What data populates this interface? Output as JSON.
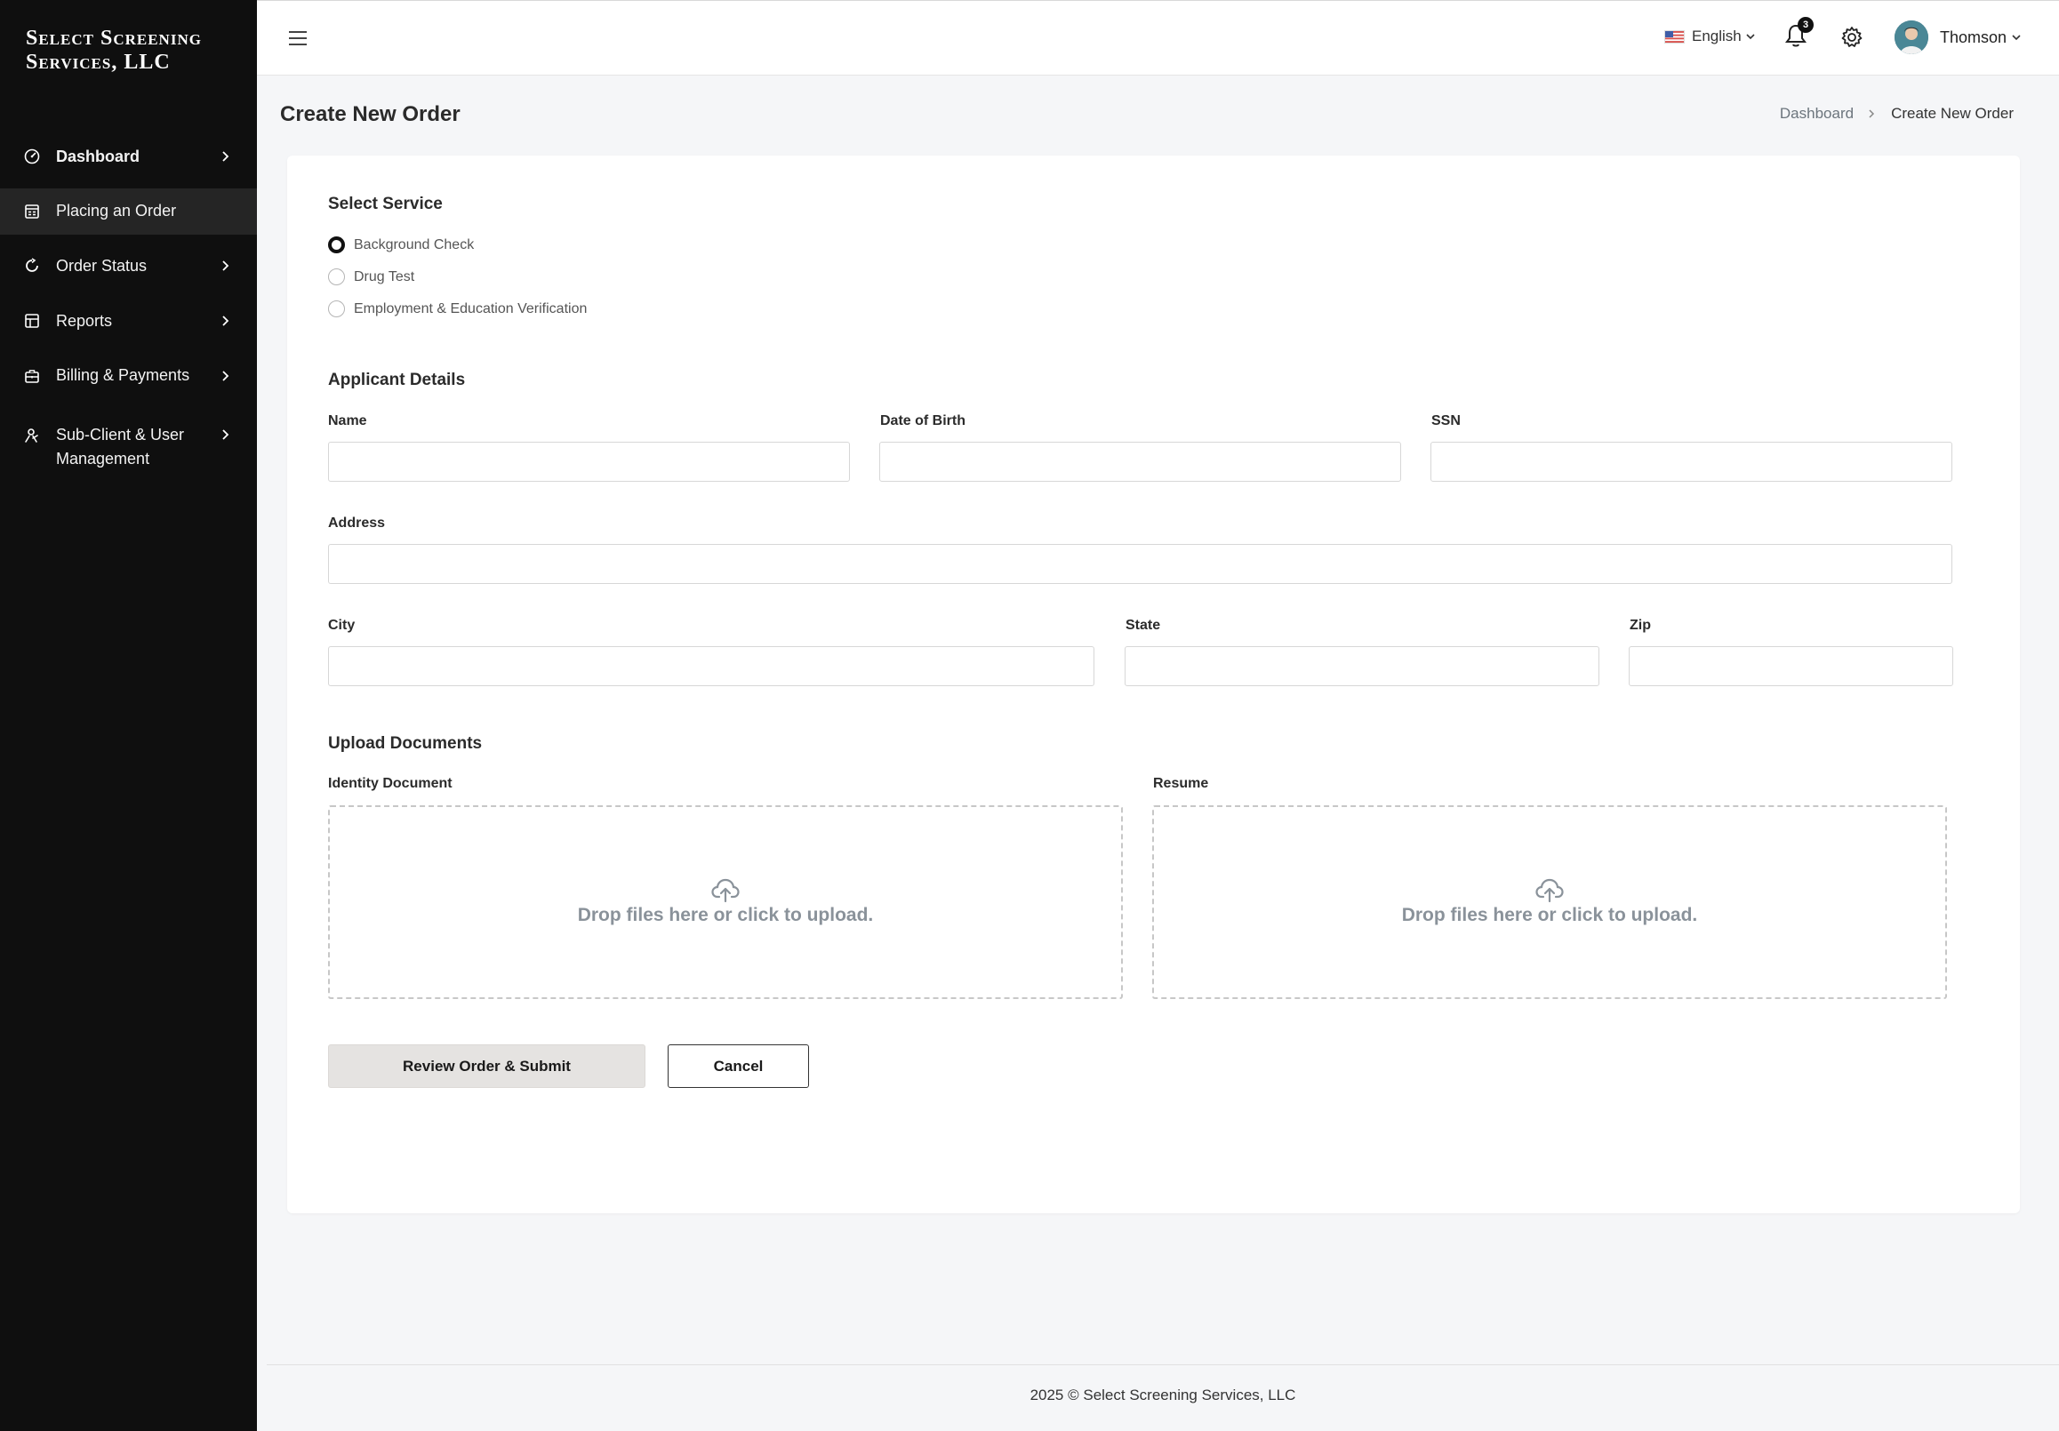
{
  "brand": {
    "line1": "Select Screening",
    "line2": "Services, LLC"
  },
  "sidebar": {
    "items": [
      {
        "label": "Dashboard",
        "icon": "dashboard-gauge-icon",
        "has_chevron": true
      },
      {
        "label": "Placing an Order",
        "icon": "order-form-icon",
        "has_chevron": false,
        "active": true
      },
      {
        "label": "Order Status",
        "icon": "refresh-icon",
        "has_chevron": true
      },
      {
        "label": "Reports",
        "icon": "reports-icon",
        "has_chevron": true
      },
      {
        "label": "Billing & Payments",
        "icon": "briefcase-icon",
        "has_chevron": true
      },
      {
        "label": "Sub-Client & User",
        "label2": "Management",
        "icon": "user-management-icon",
        "has_chevron": true
      }
    ]
  },
  "topbar": {
    "language": "English",
    "notification_count": "3",
    "user_name": "Thomson"
  },
  "page": {
    "title": "Create New Order",
    "breadcrumb": {
      "parent": "Dashboard",
      "current": "Create New Order"
    }
  },
  "form": {
    "select_service": {
      "title": "Select Service",
      "options": [
        {
          "label": "Background Check",
          "checked": true
        },
        {
          "label": "Drug Test",
          "checked": false
        },
        {
          "label": "Employment & Education Verification",
          "checked": false
        }
      ]
    },
    "applicant": {
      "title": "Applicant Details",
      "name_label": "Name",
      "name_value": "",
      "dob_label": "Date of Birth",
      "dob_value": "",
      "ssn_label": "SSN",
      "ssn_value": "",
      "address_label": "Address",
      "address_value": "",
      "city_label": "City",
      "city_value": "",
      "state_label": "State",
      "state_value": "",
      "zip_label": "Zip",
      "zip_value": ""
    },
    "upload": {
      "title": "Upload Documents",
      "identity_label": "Identity Document",
      "resume_label": "Resume",
      "drop_text": "Drop files here or click to upload."
    },
    "actions": {
      "submit": "Review Order & Submit",
      "cancel": "Cancel"
    }
  },
  "footer": {
    "text": "2025 © Select Screening Services, LLC"
  },
  "colors": {
    "sidebar_bg": "#0f0f0f",
    "active_item_bg": "#252525",
    "primary_button_bg": "#e5e3e1",
    "page_bg": "#f5f6f8"
  }
}
